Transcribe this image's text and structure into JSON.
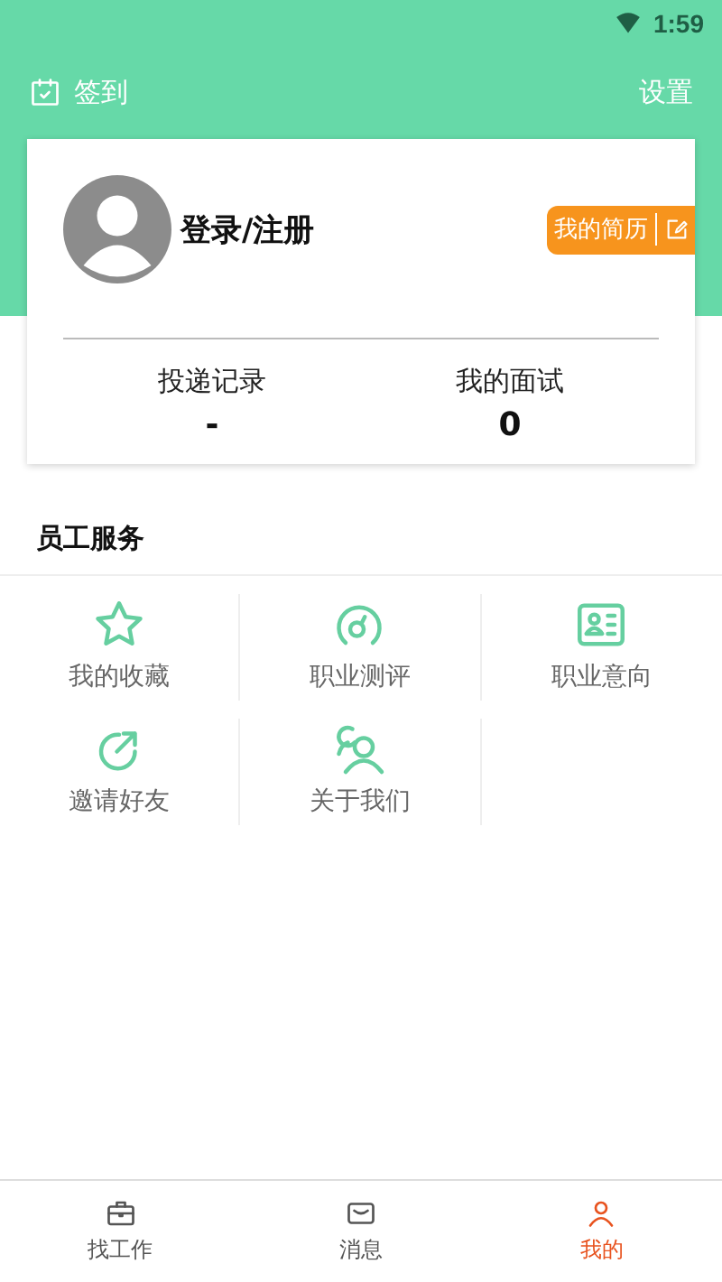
{
  "status_bar": {
    "time": "1:59"
  },
  "header": {
    "checkin": "签到",
    "settings": "设置"
  },
  "profile": {
    "name": "登录/注册",
    "resume_button": "我的简历",
    "stats": [
      {
        "label": "投递记录",
        "value": "-"
      },
      {
        "label": "我的面试",
        "value": "0"
      }
    ]
  },
  "services": {
    "title": "员工服务",
    "items": [
      {
        "kind": "star",
        "label": "我的收藏"
      },
      {
        "kind": "gauge",
        "label": "职业测评"
      },
      {
        "kind": "card",
        "label": "职业意向"
      },
      {
        "kind": "share",
        "label": "邀请好友"
      },
      {
        "kind": "people",
        "label": "关于我们"
      }
    ]
  },
  "tabs": [
    {
      "kind": "briefcase",
      "label": "找工作",
      "selected": false
    },
    {
      "kind": "mail",
      "label": "消息",
      "selected": false
    },
    {
      "kind": "person",
      "label": "我的",
      "selected": true
    }
  ]
}
